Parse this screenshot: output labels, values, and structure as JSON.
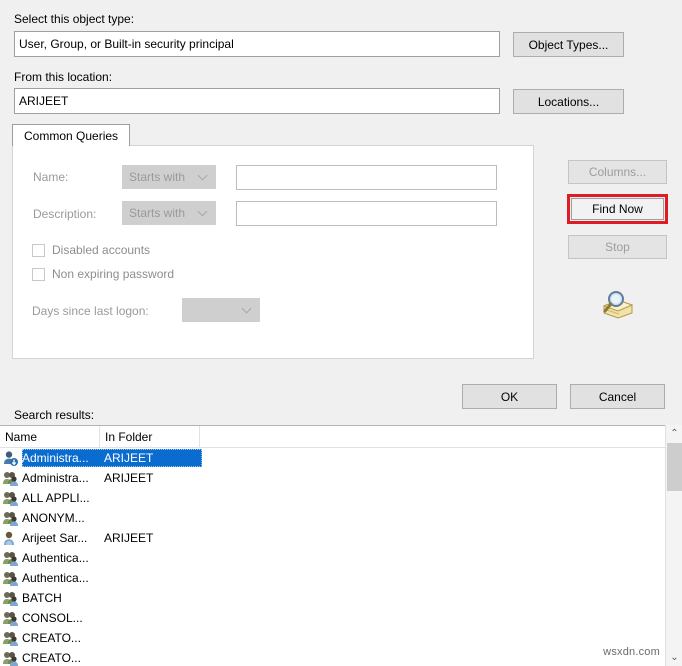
{
  "form": {
    "object_type_label": "Select this object type:",
    "object_type_value": "User, Group, or Built-in security principal",
    "object_types_button": "Object Types...",
    "location_label": "From this location:",
    "location_value": "ARIJEET",
    "locations_button": "Locations..."
  },
  "tabs": [
    {
      "label": "Common Queries",
      "active": true
    }
  ],
  "query": {
    "name_label": "Name:",
    "name_operator": "Starts with",
    "name_value": "",
    "description_label": "Description:",
    "description_operator": "Starts with",
    "description_value": "",
    "disabled_accounts_label": "Disabled accounts",
    "disabled_accounts_checked": false,
    "non_expiring_label": "Non expiring password",
    "non_expiring_checked": false,
    "days_since_logon_label": "Days since last logon:",
    "days_since_logon_value": ""
  },
  "side_buttons": {
    "columns": "Columns...",
    "find_now": "Find Now",
    "stop": "Stop",
    "find_now_highlight_color": "#e01b24"
  },
  "footer": {
    "ok": "OK",
    "cancel": "Cancel"
  },
  "results": {
    "caption": "Search results:",
    "columns": [
      "Name",
      "In Folder"
    ],
    "rows": [
      {
        "icon": "user-key-icon",
        "name": "Administra...",
        "folder": "ARIJEET",
        "selected": true
      },
      {
        "icon": "group-icon",
        "name": "Administra...",
        "folder": "ARIJEET",
        "selected": false
      },
      {
        "icon": "group-icon",
        "name": "ALL APPLI...",
        "folder": "",
        "selected": false
      },
      {
        "icon": "group-icon",
        "name": "ANONYM...",
        "folder": "",
        "selected": false
      },
      {
        "icon": "user-icon",
        "name": "Arijeet Sar...",
        "folder": "ARIJEET",
        "selected": false
      },
      {
        "icon": "group-icon",
        "name": "Authentica...",
        "folder": "",
        "selected": false
      },
      {
        "icon": "group-icon",
        "name": "Authentica...",
        "folder": "",
        "selected": false
      },
      {
        "icon": "group-icon",
        "name": "BATCH",
        "folder": "",
        "selected": false
      },
      {
        "icon": "group-icon",
        "name": "CONSOL...",
        "folder": "",
        "selected": false
      },
      {
        "icon": "group-icon",
        "name": "CREATO...",
        "folder": "",
        "selected": false
      },
      {
        "icon": "group-icon",
        "name": "CREATO...",
        "folder": "",
        "selected": false
      }
    ]
  },
  "scrollbar": {
    "up_arrow": "⌃",
    "down_arrow": "⌄"
  },
  "watermark": "wsxdn.com"
}
